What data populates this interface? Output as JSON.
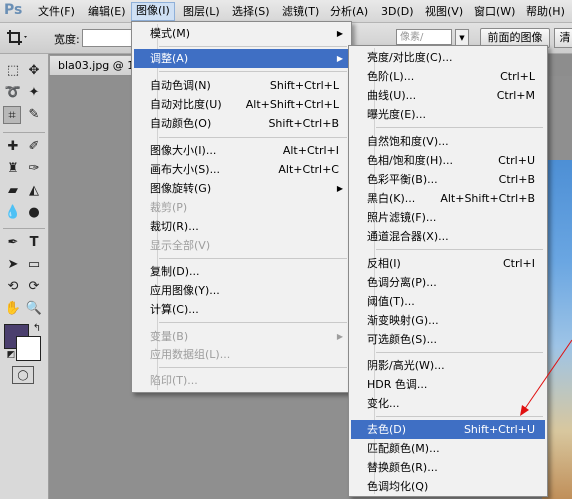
{
  "menubar": {
    "logo": "Ps",
    "items": [
      "文件(F)",
      "编辑(E)",
      "图像(I)",
      "图层(L)",
      "选择(S)",
      "滤镜(T)",
      "分析(A)",
      "3D(D)",
      "视图(V)",
      "窗口(W)",
      "帮助(H)"
    ]
  },
  "options_bar": {
    "width_label": "宽度:",
    "resolution_placeholder": "像素/",
    "front_image_button": "前面的图像",
    "clear_button": "清"
  },
  "document": {
    "tab_title": "bla03.jpg @ 10"
  },
  "image_menu": {
    "items": [
      {
        "label": "模式(M)",
        "shortcut": "",
        "submenu": true,
        "disabled": false
      },
      {
        "label": "调整(A)",
        "shortcut": "",
        "submenu": true,
        "disabled": false,
        "highlighted": true
      },
      {
        "label": "自动色调(N)",
        "shortcut": "Shift+Ctrl+L",
        "disabled": false
      },
      {
        "label": "自动对比度(U)",
        "shortcut": "Alt+Shift+Ctrl+L",
        "disabled": false
      },
      {
        "label": "自动颜色(O)",
        "shortcut": "Shift+Ctrl+B",
        "disabled": false
      },
      {
        "label": "图像大小(I)...",
        "shortcut": "Alt+Ctrl+I",
        "disabled": false
      },
      {
        "label": "画布大小(S)...",
        "shortcut": "Alt+Ctrl+C",
        "disabled": false
      },
      {
        "label": "图像旋转(G)",
        "shortcut": "",
        "submenu": true,
        "disabled": false
      },
      {
        "label": "裁剪(P)",
        "shortcut": "",
        "disabled": true
      },
      {
        "label": "裁切(R)...",
        "shortcut": "",
        "disabled": false
      },
      {
        "label": "显示全部(V)",
        "shortcut": "",
        "disabled": true
      },
      {
        "label": "复制(D)...",
        "shortcut": "",
        "disabled": false
      },
      {
        "label": "应用图像(Y)...",
        "shortcut": "",
        "disabled": false
      },
      {
        "label": "计算(C)...",
        "shortcut": "",
        "disabled": false
      },
      {
        "label": "变量(B)",
        "shortcut": "",
        "submenu": true,
        "disabled": true
      },
      {
        "label": "应用数据组(L)...",
        "shortcut": "",
        "disabled": true
      },
      {
        "label": "陷印(T)...",
        "shortcut": "",
        "disabled": true
      }
    ]
  },
  "adjust_menu": {
    "items": [
      {
        "label": "亮度/对比度(C)...",
        "shortcut": ""
      },
      {
        "label": "色阶(L)...",
        "shortcut": "Ctrl+L"
      },
      {
        "label": "曲线(U)...",
        "shortcut": "Ctrl+M"
      },
      {
        "label": "曝光度(E)...",
        "shortcut": ""
      },
      {
        "label": "自然饱和度(V)...",
        "shortcut": ""
      },
      {
        "label": "色相/饱和度(H)...",
        "shortcut": "Ctrl+U"
      },
      {
        "label": "色彩平衡(B)...",
        "shortcut": "Ctrl+B"
      },
      {
        "label": "黑白(K)...",
        "shortcut": "Alt+Shift+Ctrl+B"
      },
      {
        "label": "照片滤镜(F)...",
        "shortcut": ""
      },
      {
        "label": "通道混合器(X)...",
        "shortcut": ""
      },
      {
        "label": "反相(I)",
        "shortcut": "Ctrl+I"
      },
      {
        "label": "色调分离(P)...",
        "shortcut": ""
      },
      {
        "label": "阈值(T)...",
        "shortcut": ""
      },
      {
        "label": "渐变映射(G)...",
        "shortcut": ""
      },
      {
        "label": "可选颜色(S)...",
        "shortcut": ""
      },
      {
        "label": "阴影/高光(W)...",
        "shortcut": ""
      },
      {
        "label": "HDR 色调...",
        "shortcut": ""
      },
      {
        "label": "变化...",
        "shortcut": ""
      },
      {
        "label": "去色(D)",
        "shortcut": "Shift+Ctrl+U",
        "highlighted": true
      },
      {
        "label": "匹配颜色(M)...",
        "shortcut": ""
      },
      {
        "label": "替换颜色(R)...",
        "shortcut": ""
      },
      {
        "label": "色调均化(Q)",
        "shortcut": ""
      }
    ]
  },
  "colors": {
    "highlight": "#3f6fc4",
    "foreground_swatch": "#4b3f6e",
    "annotation_arrow": "#e01010"
  }
}
